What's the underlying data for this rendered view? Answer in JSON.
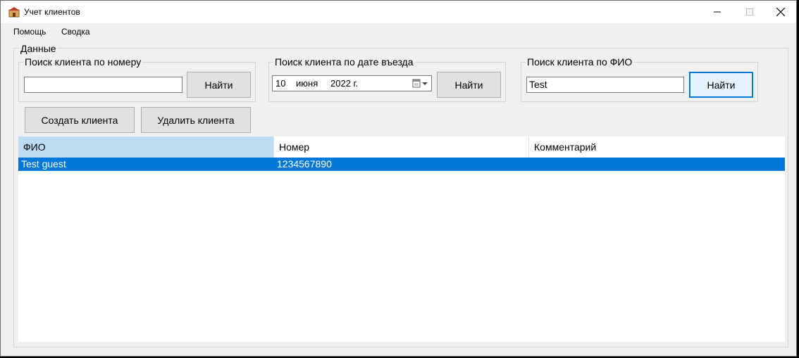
{
  "window": {
    "title": "Учет клиентов"
  },
  "menu": {
    "items": [
      "Помощь",
      "Сводка"
    ]
  },
  "data_group": {
    "label": "Данные"
  },
  "search_by_number": {
    "label": "Поиск клиента по номеру",
    "value": "",
    "button": "Найти"
  },
  "search_by_date": {
    "label": "Поиск клиента по дате въезда",
    "day": "10",
    "month": "июня",
    "year": "2022 г.",
    "button": "Найти"
  },
  "search_by_name": {
    "label": "Поиск клиента по ФИО",
    "value": "Test",
    "button": "Найти"
  },
  "actions": {
    "create": "Создать клиента",
    "delete": "Удалить клиента"
  },
  "grid": {
    "columns": [
      "ФИО",
      "Номер",
      "Комментарий"
    ],
    "rows": [
      {
        "name": "Test guest",
        "number": "1234567890",
        "comment": ""
      }
    ]
  }
}
